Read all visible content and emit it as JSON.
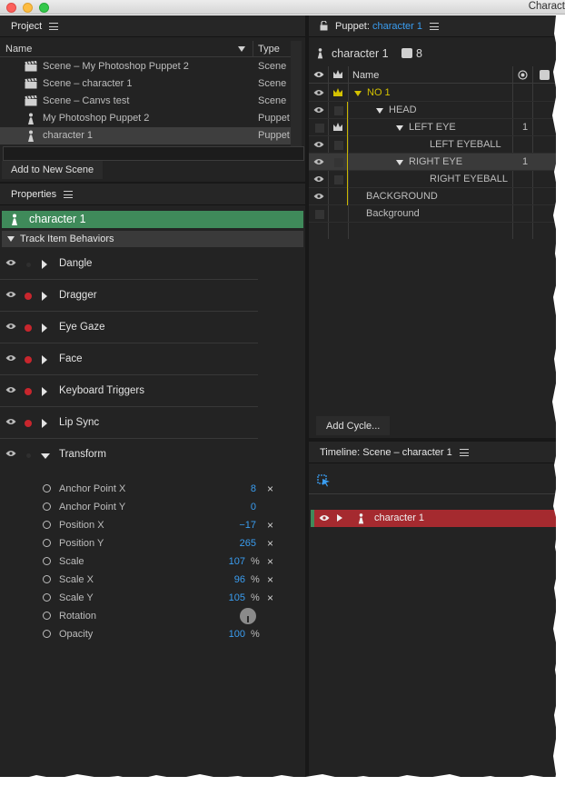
{
  "window": {
    "title": "Charact"
  },
  "project": {
    "title": "Project",
    "columns": {
      "name": "Name",
      "type": "Type"
    },
    "items": [
      {
        "name": "Scene – My Photoshop Puppet 2",
        "type": "Scene",
        "icon": "scene-clapper-icon"
      },
      {
        "name": "Scene – character 1",
        "type": "Scene",
        "icon": "scene-clapper-icon"
      },
      {
        "name": "Scene – Canvs test",
        "type": "Scene",
        "icon": "scene-clapper-icon"
      },
      {
        "name": "My Photoshop Puppet 2",
        "type": "Puppet",
        "icon": "puppet-icon"
      },
      {
        "name": "character 1",
        "type": "Puppet",
        "icon": "puppet-icon"
      }
    ],
    "add_button": "Add to New Scene"
  },
  "properties": {
    "title": "Properties",
    "character": "character 1",
    "section": "Track Item Behaviors",
    "behaviors": [
      {
        "name": "Dangle",
        "armed": false
      },
      {
        "name": "Dragger",
        "armed": true
      },
      {
        "name": "Eye Gaze",
        "armed": true
      },
      {
        "name": "Face",
        "armed": true
      },
      {
        "name": "Keyboard Triggers",
        "armed": true
      },
      {
        "name": "Lip Sync",
        "armed": true
      },
      {
        "name": "Transform",
        "armed": false,
        "expanded": true
      }
    ],
    "transform_params": [
      {
        "name": "Anchor Point X",
        "value": "8",
        "unit": "",
        "reset": true
      },
      {
        "name": "Anchor Point Y",
        "value": "0",
        "unit": "",
        "reset": false
      },
      {
        "name": "Position X",
        "value": "−17",
        "unit": "",
        "reset": true
      },
      {
        "name": "Position Y",
        "value": "265",
        "unit": "",
        "reset": true
      },
      {
        "name": "Scale",
        "value": "107",
        "unit": "%",
        "reset": true
      },
      {
        "name": "Scale X",
        "value": "96",
        "unit": "%",
        "reset": true
      },
      {
        "name": "Scale Y",
        "value": "105",
        "unit": "%",
        "reset": true
      },
      {
        "name": "Rotation",
        "value": "",
        "unit": "",
        "reset": false
      },
      {
        "name": "Opacity",
        "value": "100",
        "unit": "%",
        "reset": false
      }
    ],
    "reset_glyph": "×"
  },
  "puppet": {
    "title_prefix": "Puppet:",
    "title_name": "character 1",
    "subtitle": "character 1",
    "layer_count": "8",
    "column_name": "Name",
    "layers": [
      {
        "name": "NO 1",
        "depth": 0,
        "expanded": true,
        "highlight": true,
        "crown": true,
        "visible": true,
        "num": ""
      },
      {
        "name": "HEAD",
        "depth": 1,
        "expanded": true,
        "crown": false,
        "visible": true,
        "num": ""
      },
      {
        "name": "LEFT EYE",
        "depth": 2,
        "expanded": true,
        "crown": true,
        "visible": false,
        "num": "1"
      },
      {
        "name": "LEFT EYEBALL",
        "depth": 3,
        "expanded": false,
        "crown": false,
        "visible": true,
        "num": ""
      },
      {
        "name": "RIGHT EYE",
        "depth": 2,
        "expanded": true,
        "crown": false,
        "visible": true,
        "num": "1",
        "selected": true
      },
      {
        "name": "RIGHT EYEBALL",
        "depth": 3,
        "expanded": false,
        "crown": false,
        "visible": true,
        "num": ""
      },
      {
        "name": "BACKGROUND",
        "depth": -1,
        "expanded": false,
        "crown": false,
        "visible": true,
        "num": ""
      },
      {
        "name": "Background",
        "depth": -1,
        "expanded": false,
        "crown": false,
        "visible": false,
        "num": ""
      }
    ],
    "add_cycle": "Add Cycle..."
  },
  "timeline": {
    "title": "Timeline: Scene – character 1",
    "track": "character 1"
  },
  "colors": {
    "accent_blue": "#3a9df0",
    "arm_red": "#c8262d",
    "selected_green": "#3f8a5a",
    "track_red": "#a52a2f",
    "crown_yellow": "#d4c200"
  }
}
